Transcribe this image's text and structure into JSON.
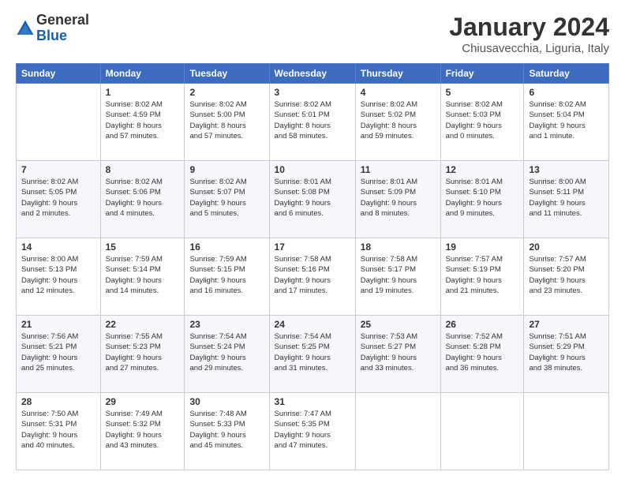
{
  "logo": {
    "line1": "General",
    "line2": "Blue"
  },
  "title": "January 2024",
  "subtitle": "Chiusavecchia, Liguria, Italy",
  "weekdays": [
    "Sunday",
    "Monday",
    "Tuesday",
    "Wednesday",
    "Thursday",
    "Friday",
    "Saturday"
  ],
  "weeks": [
    [
      {
        "day": "",
        "info": ""
      },
      {
        "day": "1",
        "info": "Sunrise: 8:02 AM\nSunset: 4:59 PM\nDaylight: 8 hours\nand 57 minutes."
      },
      {
        "day": "2",
        "info": "Sunrise: 8:02 AM\nSunset: 5:00 PM\nDaylight: 8 hours\nand 57 minutes."
      },
      {
        "day": "3",
        "info": "Sunrise: 8:02 AM\nSunset: 5:01 PM\nDaylight: 8 hours\nand 58 minutes."
      },
      {
        "day": "4",
        "info": "Sunrise: 8:02 AM\nSunset: 5:02 PM\nDaylight: 8 hours\nand 59 minutes."
      },
      {
        "day": "5",
        "info": "Sunrise: 8:02 AM\nSunset: 5:03 PM\nDaylight: 9 hours\nand 0 minutes."
      },
      {
        "day": "6",
        "info": "Sunrise: 8:02 AM\nSunset: 5:04 PM\nDaylight: 9 hours\nand 1 minute."
      }
    ],
    [
      {
        "day": "7",
        "info": "Sunrise: 8:02 AM\nSunset: 5:05 PM\nDaylight: 9 hours\nand 2 minutes."
      },
      {
        "day": "8",
        "info": "Sunrise: 8:02 AM\nSunset: 5:06 PM\nDaylight: 9 hours\nand 4 minutes."
      },
      {
        "day": "9",
        "info": "Sunrise: 8:02 AM\nSunset: 5:07 PM\nDaylight: 9 hours\nand 5 minutes."
      },
      {
        "day": "10",
        "info": "Sunrise: 8:01 AM\nSunset: 5:08 PM\nDaylight: 9 hours\nand 6 minutes."
      },
      {
        "day": "11",
        "info": "Sunrise: 8:01 AM\nSunset: 5:09 PM\nDaylight: 9 hours\nand 8 minutes."
      },
      {
        "day": "12",
        "info": "Sunrise: 8:01 AM\nSunset: 5:10 PM\nDaylight: 9 hours\nand 9 minutes."
      },
      {
        "day": "13",
        "info": "Sunrise: 8:00 AM\nSunset: 5:11 PM\nDaylight: 9 hours\nand 11 minutes."
      }
    ],
    [
      {
        "day": "14",
        "info": "Sunrise: 8:00 AM\nSunset: 5:13 PM\nDaylight: 9 hours\nand 12 minutes."
      },
      {
        "day": "15",
        "info": "Sunrise: 7:59 AM\nSunset: 5:14 PM\nDaylight: 9 hours\nand 14 minutes."
      },
      {
        "day": "16",
        "info": "Sunrise: 7:59 AM\nSunset: 5:15 PM\nDaylight: 9 hours\nand 16 minutes."
      },
      {
        "day": "17",
        "info": "Sunrise: 7:58 AM\nSunset: 5:16 PM\nDaylight: 9 hours\nand 17 minutes."
      },
      {
        "day": "18",
        "info": "Sunrise: 7:58 AM\nSunset: 5:17 PM\nDaylight: 9 hours\nand 19 minutes."
      },
      {
        "day": "19",
        "info": "Sunrise: 7:57 AM\nSunset: 5:19 PM\nDaylight: 9 hours\nand 21 minutes."
      },
      {
        "day": "20",
        "info": "Sunrise: 7:57 AM\nSunset: 5:20 PM\nDaylight: 9 hours\nand 23 minutes."
      }
    ],
    [
      {
        "day": "21",
        "info": "Sunrise: 7:56 AM\nSunset: 5:21 PM\nDaylight: 9 hours\nand 25 minutes."
      },
      {
        "day": "22",
        "info": "Sunrise: 7:55 AM\nSunset: 5:23 PM\nDaylight: 9 hours\nand 27 minutes."
      },
      {
        "day": "23",
        "info": "Sunrise: 7:54 AM\nSunset: 5:24 PM\nDaylight: 9 hours\nand 29 minutes."
      },
      {
        "day": "24",
        "info": "Sunrise: 7:54 AM\nSunset: 5:25 PM\nDaylight: 9 hours\nand 31 minutes."
      },
      {
        "day": "25",
        "info": "Sunrise: 7:53 AM\nSunset: 5:27 PM\nDaylight: 9 hours\nand 33 minutes."
      },
      {
        "day": "26",
        "info": "Sunrise: 7:52 AM\nSunset: 5:28 PM\nDaylight: 9 hours\nand 36 minutes."
      },
      {
        "day": "27",
        "info": "Sunrise: 7:51 AM\nSunset: 5:29 PM\nDaylight: 9 hours\nand 38 minutes."
      }
    ],
    [
      {
        "day": "28",
        "info": "Sunrise: 7:50 AM\nSunset: 5:31 PM\nDaylight: 9 hours\nand 40 minutes."
      },
      {
        "day": "29",
        "info": "Sunrise: 7:49 AM\nSunset: 5:32 PM\nDaylight: 9 hours\nand 43 minutes."
      },
      {
        "day": "30",
        "info": "Sunrise: 7:48 AM\nSunset: 5:33 PM\nDaylight: 9 hours\nand 45 minutes."
      },
      {
        "day": "31",
        "info": "Sunrise: 7:47 AM\nSunset: 5:35 PM\nDaylight: 9 hours\nand 47 minutes."
      },
      {
        "day": "",
        "info": ""
      },
      {
        "day": "",
        "info": ""
      },
      {
        "day": "",
        "info": ""
      }
    ]
  ]
}
